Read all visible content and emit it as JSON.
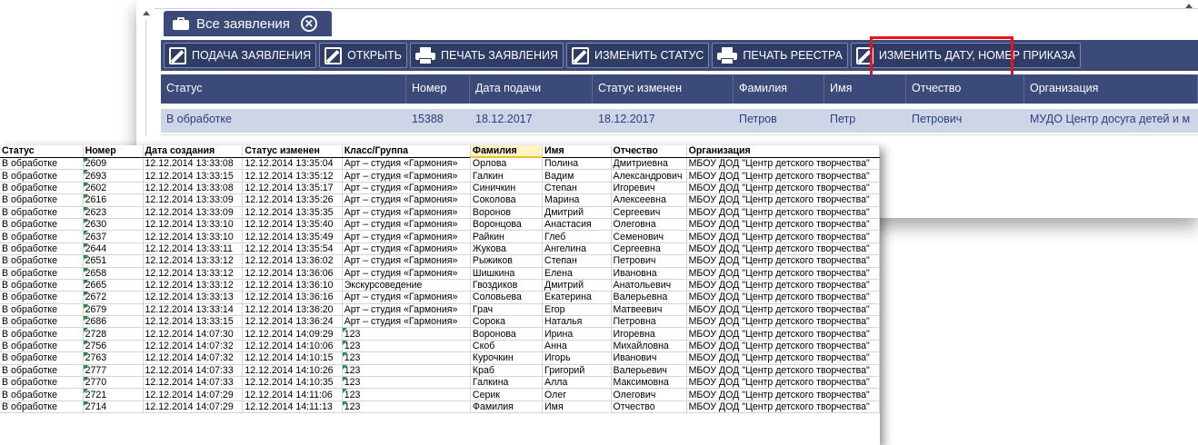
{
  "app": {
    "tab": {
      "label": "Все заявления"
    },
    "toolbar": [
      {
        "label": "ПОДАЧА ЗАЯВЛЕНИЯ",
        "icon": "edit-icon"
      },
      {
        "label": "ОТКРЫТЬ",
        "icon": "edit-icon"
      },
      {
        "label": "ПЕЧАТЬ ЗАЯВЛЕНИЯ",
        "icon": "printer-icon"
      },
      {
        "label": "ИЗМЕНИТЬ СТАТУС",
        "icon": "edit-icon"
      },
      {
        "label": "ПЕЧАТЬ РЕЕСТРА",
        "icon": "printer-icon"
      },
      {
        "label": "ИЗМЕНИТЬ ДАТУ, НОМЕР ПРИКАЗА",
        "icon": "edit-icon"
      }
    ],
    "highlight_color": "#e8141a",
    "grid": {
      "columns": [
        "Статус",
        "Номер",
        "Дата подачи",
        "Статус изменен",
        "Фамилия",
        "Имя",
        "Отчество",
        "Организация"
      ],
      "rows": [
        [
          "В обработке",
          "15388",
          "18.12.2017",
          "18.12.2017",
          "Петров",
          "Петр",
          "Петрович",
          "МУДО Центр досуга детей и м"
        ]
      ]
    }
  },
  "sheet": {
    "columns": [
      "Статус",
      "Номер",
      "Дата создания",
      "Статус изменен",
      "Класс/Группа",
      "Фамилия",
      "Имя",
      "Отчество",
      "Организация"
    ],
    "rows": [
      [
        "В обработке",
        "2609",
        "12.12.2014 13:33:08",
        "12.12.2014 13:35:04",
        "Арт – студия «Гармония»",
        "Орлова",
        "Полина",
        "Дмитриевна",
        "МБОУ ДОД \"Центр детского творчества\""
      ],
      [
        "В обработке",
        "2693",
        "12.12.2014 13:33:15",
        "12.12.2014 13:35:12",
        "Арт – студия «Гармония»",
        "Галкин",
        "Вадим",
        "Александрович",
        "МБОУ ДОД \"Центр детского творчества\""
      ],
      [
        "В обработке",
        "2602",
        "12.12.2014 13:33:08",
        "12.12.2014 13:35:17",
        "Арт – студия «Гармония»",
        "Синичкин",
        "Степан",
        "Игоревич",
        "МБОУ ДОД \"Центр детского творчества\""
      ],
      [
        "В обработке",
        "2616",
        "12.12.2014 13:33:09",
        "12.12.2014 13:35:26",
        "Арт – студия «Гармония»",
        "Соколова",
        "Марина",
        "Алексеевна",
        "МБОУ ДОД \"Центр детского творчества\""
      ],
      [
        "В обработке",
        "2623",
        "12.12.2014 13:33:09",
        "12.12.2014 13:35:35",
        "Арт – студия «Гармония»",
        "Воронов",
        "Дмитрий",
        "Сергеевич",
        "МБОУ ДОД \"Центр детского творчества\""
      ],
      [
        "В обработке",
        "2630",
        "12.12.2014 13:33:10",
        "12.12.2014 13:35:40",
        "Арт – студия «Гармония»",
        "Воронцова",
        "Анастасия",
        "Олеговна",
        "МБОУ ДОД \"Центр детского творчества\""
      ],
      [
        "В обработке",
        "2637",
        "12.12.2014 13:33:10",
        "12.12.2014 13:35:49",
        "Арт – студия «Гармония»",
        "Райкин",
        "Глеб",
        "Семенович",
        "МБОУ ДОД \"Центр детского творчества\""
      ],
      [
        "В обработке",
        "2644",
        "12.12.2014 13:33:11",
        "12.12.2014 13:35:54",
        "Арт – студия «Гармония»",
        "Жукова",
        "Ангелина",
        "Сергеевна",
        "МБОУ ДОД \"Центр детского творчества\""
      ],
      [
        "В обработке",
        "2651",
        "12.12.2014 13:33:12",
        "12.12.2014 13:36:02",
        "Арт – студия «Гармония»",
        "Рыжиков",
        "Степан",
        "Петрович",
        "МБОУ ДОД \"Центр детского творчества\""
      ],
      [
        "В обработке",
        "2658",
        "12.12.2014 13:33:12",
        "12.12.2014 13:36:06",
        "Арт – студия «Гармония»",
        "Шишкина",
        "Елена",
        "Ивановна",
        "МБОУ ДОД \"Центр детского творчества\""
      ],
      [
        "В обработке",
        "2665",
        "12.12.2014 13:33:12",
        "12.12.2014 13:36:10",
        "Экскурсоведение",
        "Гвоздиков",
        "Дмитрий",
        "Анатольевич",
        "МБОУ ДОД \"Центр детского творчества\""
      ],
      [
        "В обработке",
        "2672",
        "12.12.2014 13:33:13",
        "12.12.2014 13:36:16",
        "Арт – студия «Гармония»",
        "Соловьева",
        "Екатерина",
        "Валерьевна",
        "МБОУ ДОД \"Центр детского творчества\""
      ],
      [
        "В обработке",
        "2679",
        "12.12.2014 13:33:14",
        "12.12.2014 13:36:20",
        "Арт – студия «Гармония»",
        "Грач",
        "Егор",
        "Матвеевич",
        "МБОУ ДОД \"Центр детского творчества\""
      ],
      [
        "В обработке",
        "2686",
        "12.12.2014 13:33:15",
        "12.12.2014 13:36:24",
        "Арт – студия «Гармония»",
        "Сорока",
        "Наталья",
        "Петровна",
        "МБОУ ДОД \"Центр детского творчества\""
      ],
      [
        "В обработке",
        "2728",
        "12.12.2014 14:07:30",
        "12.12.2014 14:09:29",
        "123",
        "Воронова",
        "Ирина",
        "Игоревна",
        "МБОУ ДОД \"Центр детского творчества\""
      ],
      [
        "В обработке",
        "2756",
        "12.12.2014 14:07:32",
        "12.12.2014 14:10:06",
        "123",
        "Скоб",
        "Анна",
        "Михайловна",
        "МБОУ ДОД \"Центр детского творчества\""
      ],
      [
        "В обработке",
        "2763",
        "12.12.2014 14:07:32",
        "12.12.2014 14:10:15",
        "123",
        "Курочкин",
        "Игорь",
        "Иванович",
        "МБОУ ДОД \"Центр детского творчества\""
      ],
      [
        "В обработке",
        "2777",
        "12.12.2014 14:07:33",
        "12.12.2014 14:10:26",
        "123",
        "Краб",
        "Григорий",
        "Валерьевич",
        "МБОУ ДОД \"Центр детского творчества\""
      ],
      [
        "В обработке",
        "2770",
        "12.12.2014 14:07:33",
        "12.12.2014 14:10:35",
        "123",
        "Галкина",
        "Алла",
        "Максимовна",
        "МБОУ ДОД \"Центр детского творчества\""
      ],
      [
        "В обработке",
        "2721",
        "12.12.2014 14:07:29",
        "12.12.2014 14:11:06",
        "123",
        "Серик",
        "Олег",
        "Олегович",
        "МБОУ ДОД \"Центр детского творчества\""
      ],
      [
        "В обработке",
        "2714",
        "12.12.2014 14:07:29",
        "12.12.2014 14:11:13",
        "123",
        "Фамилия",
        "Имя",
        "Отчество",
        "МБОУ ДОД \"Центр детского творчества\""
      ]
    ],
    "selected_column": "Фамилия",
    "marker_color": "#1e8f3a"
  }
}
